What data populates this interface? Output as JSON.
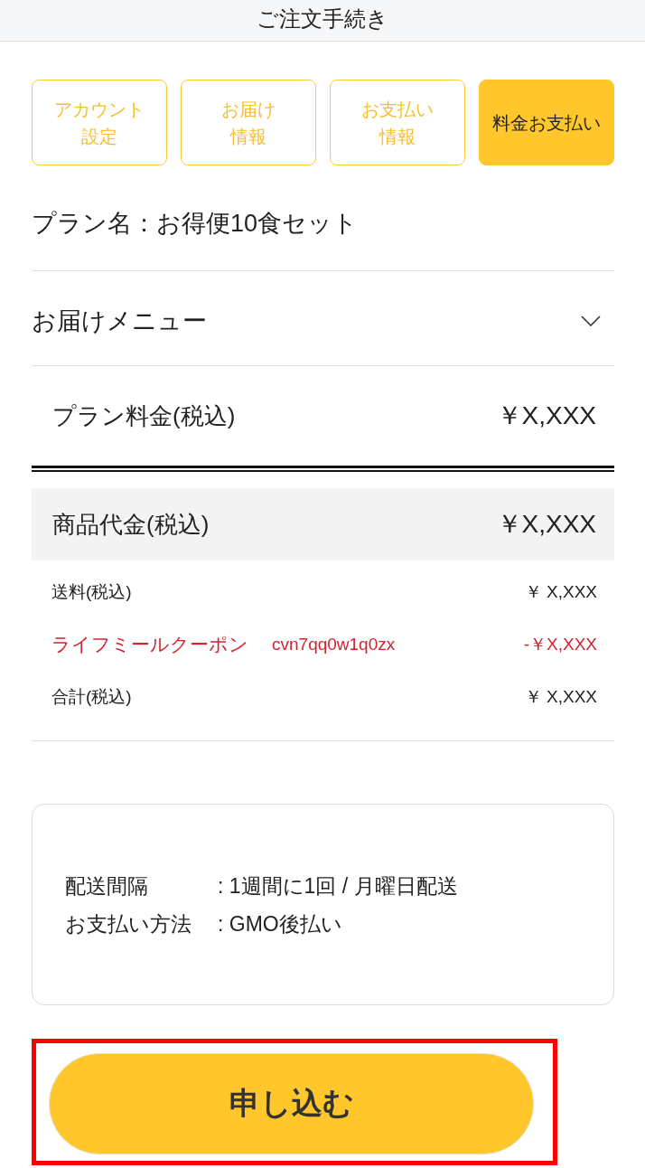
{
  "header": {
    "title": "ご注文手続き"
  },
  "steps": [
    {
      "lines": [
        "アカウント",
        "設定"
      ],
      "selected": false
    },
    {
      "lines": [
        "お届け",
        "情報"
      ],
      "selected": false
    },
    {
      "lines": [
        "お支払い",
        "情報"
      ],
      "selected": false
    },
    {
      "lines": [
        "料金お支払い"
      ],
      "selected": true
    }
  ],
  "plan_name": "プラン名：お得便10食セット",
  "delivery_menu": {
    "label": "お届けメニュー",
    "expanded": false
  },
  "plan_price": {
    "label": "プラン料金(税込)",
    "amount": "￥X,XXX"
  },
  "subtotal": {
    "label": "商品代金(税込)",
    "amount": "￥X,XXX"
  },
  "charges": [
    {
      "kind": "fee",
      "label": "送料(税込)",
      "amount": "￥ X,XXX"
    },
    {
      "kind": "discount",
      "label": "ライフミールクーポン",
      "code": "cvn7qq0w1q0zx",
      "amount": "-￥X,XXX"
    },
    {
      "kind": "fee",
      "label": "合計(税込)",
      "amount": "￥ X,XXX"
    }
  ],
  "summary": [
    {
      "label": "配送間隔",
      "value": ": 1週間に1回 / 月曜日配送"
    },
    {
      "label": "お支払い方法",
      "value": ": GMO後払い"
    }
  ],
  "submit_button": {
    "label": "申し込む",
    "highlighted": true
  }
}
